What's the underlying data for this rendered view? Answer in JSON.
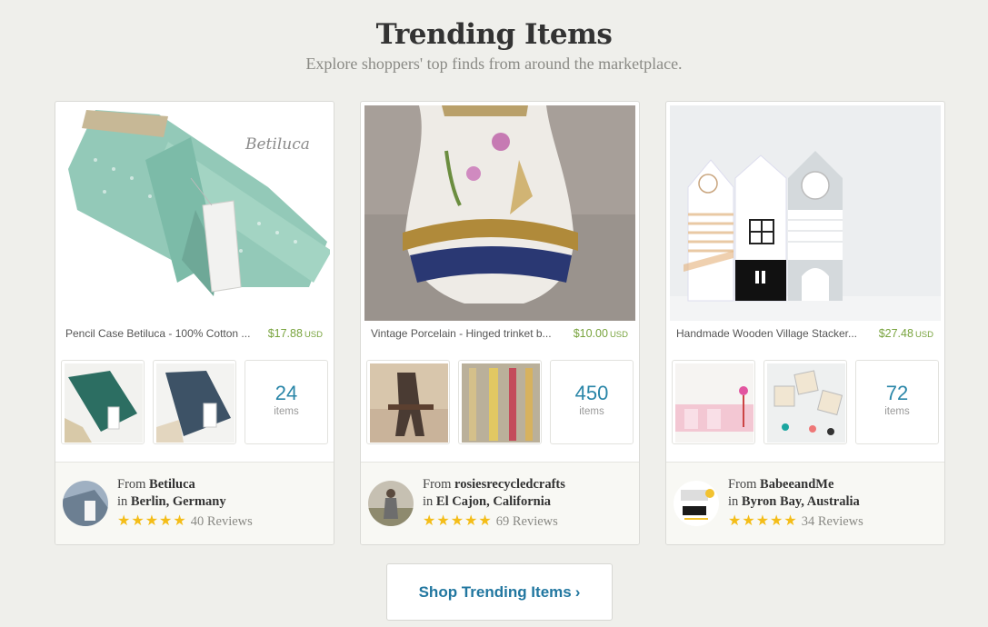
{
  "header": {
    "title": "Trending Items",
    "subtitle": "Explore shoppers' top finds from around the marketplace."
  },
  "cards": [
    {
      "item_title": "Pencil Case Betiluca - 100% Cotton ...",
      "price": "$17.88",
      "currency": "USD",
      "brand_watermark": "Betiluca",
      "count": "24",
      "count_label": "items",
      "from_label": "From",
      "shop": "Betiluca",
      "in_label": "in",
      "location": "Berlin, Germany",
      "stars": "★★★★★",
      "reviews": "40 Reviews"
    },
    {
      "item_title": "Vintage Porcelain - Hinged trinket b...",
      "price": "$10.00",
      "currency": "USD",
      "count": "450",
      "count_label": "items",
      "from_label": "From",
      "shop": "rosiesrecycledcrafts",
      "in_label": "in",
      "location": "El Cajon, California",
      "stars": "★★★★★",
      "reviews": "69 Reviews"
    },
    {
      "item_title": "Handmade Wooden Village Stacker...",
      "price": "$27.48",
      "currency": "USD",
      "count": "72",
      "count_label": "items",
      "from_label": "From",
      "shop": "BabeeandMe",
      "in_label": "in",
      "location": "Byron Bay, Australia",
      "stars": "★★★★★",
      "reviews": "34 Reviews"
    }
  ],
  "cta": {
    "label": "Shop Trending Items",
    "chevron": "›"
  },
  "colors": {
    "background": "#efefeb",
    "price": "#78a33d",
    "accent": "#2277a0",
    "star": "#f4bd18"
  }
}
